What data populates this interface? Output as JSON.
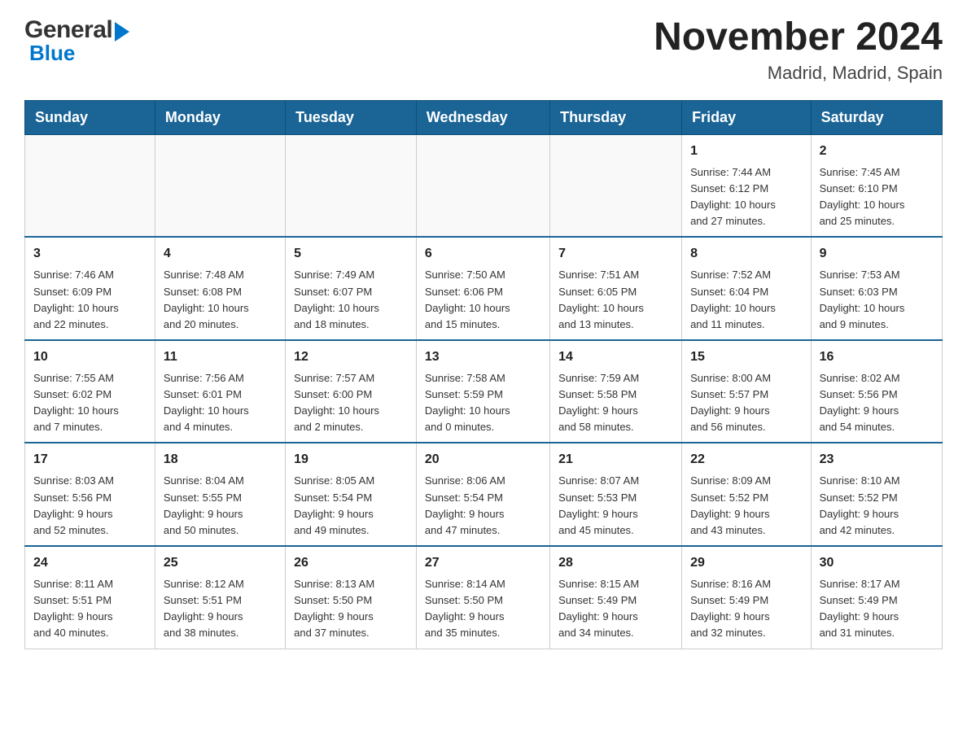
{
  "header": {
    "logo_general": "General",
    "logo_blue": "Blue",
    "month_title": "November 2024",
    "location": "Madrid, Madrid, Spain"
  },
  "weekdays": [
    "Sunday",
    "Monday",
    "Tuesday",
    "Wednesday",
    "Thursday",
    "Friday",
    "Saturday"
  ],
  "weeks": [
    [
      {
        "day": "",
        "info": ""
      },
      {
        "day": "",
        "info": ""
      },
      {
        "day": "",
        "info": ""
      },
      {
        "day": "",
        "info": ""
      },
      {
        "day": "",
        "info": ""
      },
      {
        "day": "1",
        "info": "Sunrise: 7:44 AM\nSunset: 6:12 PM\nDaylight: 10 hours\nand 27 minutes."
      },
      {
        "day": "2",
        "info": "Sunrise: 7:45 AM\nSunset: 6:10 PM\nDaylight: 10 hours\nand 25 minutes."
      }
    ],
    [
      {
        "day": "3",
        "info": "Sunrise: 7:46 AM\nSunset: 6:09 PM\nDaylight: 10 hours\nand 22 minutes."
      },
      {
        "day": "4",
        "info": "Sunrise: 7:48 AM\nSunset: 6:08 PM\nDaylight: 10 hours\nand 20 minutes."
      },
      {
        "day": "5",
        "info": "Sunrise: 7:49 AM\nSunset: 6:07 PM\nDaylight: 10 hours\nand 18 minutes."
      },
      {
        "day": "6",
        "info": "Sunrise: 7:50 AM\nSunset: 6:06 PM\nDaylight: 10 hours\nand 15 minutes."
      },
      {
        "day": "7",
        "info": "Sunrise: 7:51 AM\nSunset: 6:05 PM\nDaylight: 10 hours\nand 13 minutes."
      },
      {
        "day": "8",
        "info": "Sunrise: 7:52 AM\nSunset: 6:04 PM\nDaylight: 10 hours\nand 11 minutes."
      },
      {
        "day": "9",
        "info": "Sunrise: 7:53 AM\nSunset: 6:03 PM\nDaylight: 10 hours\nand 9 minutes."
      }
    ],
    [
      {
        "day": "10",
        "info": "Sunrise: 7:55 AM\nSunset: 6:02 PM\nDaylight: 10 hours\nand 7 minutes."
      },
      {
        "day": "11",
        "info": "Sunrise: 7:56 AM\nSunset: 6:01 PM\nDaylight: 10 hours\nand 4 minutes."
      },
      {
        "day": "12",
        "info": "Sunrise: 7:57 AM\nSunset: 6:00 PM\nDaylight: 10 hours\nand 2 minutes."
      },
      {
        "day": "13",
        "info": "Sunrise: 7:58 AM\nSunset: 5:59 PM\nDaylight: 10 hours\nand 0 minutes."
      },
      {
        "day": "14",
        "info": "Sunrise: 7:59 AM\nSunset: 5:58 PM\nDaylight: 9 hours\nand 58 minutes."
      },
      {
        "day": "15",
        "info": "Sunrise: 8:00 AM\nSunset: 5:57 PM\nDaylight: 9 hours\nand 56 minutes."
      },
      {
        "day": "16",
        "info": "Sunrise: 8:02 AM\nSunset: 5:56 PM\nDaylight: 9 hours\nand 54 minutes."
      }
    ],
    [
      {
        "day": "17",
        "info": "Sunrise: 8:03 AM\nSunset: 5:56 PM\nDaylight: 9 hours\nand 52 minutes."
      },
      {
        "day": "18",
        "info": "Sunrise: 8:04 AM\nSunset: 5:55 PM\nDaylight: 9 hours\nand 50 minutes."
      },
      {
        "day": "19",
        "info": "Sunrise: 8:05 AM\nSunset: 5:54 PM\nDaylight: 9 hours\nand 49 minutes."
      },
      {
        "day": "20",
        "info": "Sunrise: 8:06 AM\nSunset: 5:54 PM\nDaylight: 9 hours\nand 47 minutes."
      },
      {
        "day": "21",
        "info": "Sunrise: 8:07 AM\nSunset: 5:53 PM\nDaylight: 9 hours\nand 45 minutes."
      },
      {
        "day": "22",
        "info": "Sunrise: 8:09 AM\nSunset: 5:52 PM\nDaylight: 9 hours\nand 43 minutes."
      },
      {
        "day": "23",
        "info": "Sunrise: 8:10 AM\nSunset: 5:52 PM\nDaylight: 9 hours\nand 42 minutes."
      }
    ],
    [
      {
        "day": "24",
        "info": "Sunrise: 8:11 AM\nSunset: 5:51 PM\nDaylight: 9 hours\nand 40 minutes."
      },
      {
        "day": "25",
        "info": "Sunrise: 8:12 AM\nSunset: 5:51 PM\nDaylight: 9 hours\nand 38 minutes."
      },
      {
        "day": "26",
        "info": "Sunrise: 8:13 AM\nSunset: 5:50 PM\nDaylight: 9 hours\nand 37 minutes."
      },
      {
        "day": "27",
        "info": "Sunrise: 8:14 AM\nSunset: 5:50 PM\nDaylight: 9 hours\nand 35 minutes."
      },
      {
        "day": "28",
        "info": "Sunrise: 8:15 AM\nSunset: 5:49 PM\nDaylight: 9 hours\nand 34 minutes."
      },
      {
        "day": "29",
        "info": "Sunrise: 8:16 AM\nSunset: 5:49 PM\nDaylight: 9 hours\nand 32 minutes."
      },
      {
        "day": "30",
        "info": "Sunrise: 8:17 AM\nSunset: 5:49 PM\nDaylight: 9 hours\nand 31 minutes."
      }
    ]
  ],
  "accent_color": "#1a6496"
}
